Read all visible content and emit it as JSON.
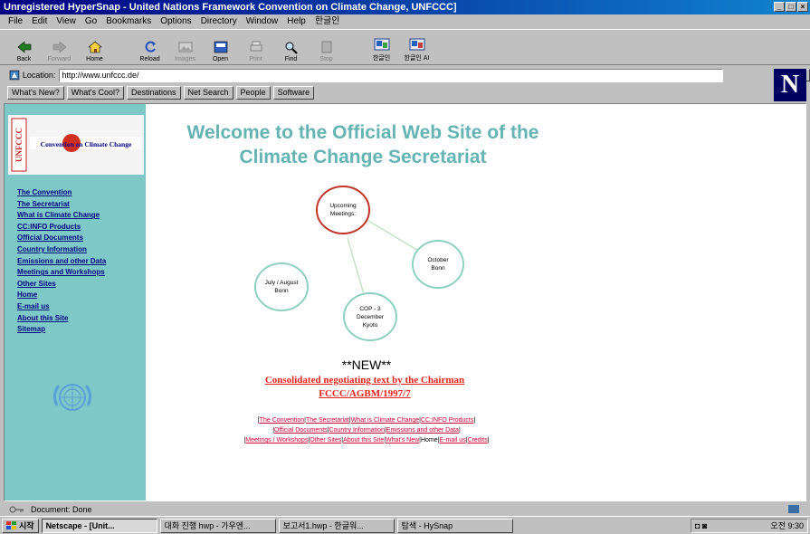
{
  "window": {
    "title": "Unregistered HyperSnap - United Nations Framework Convention on Climate Change, UNFCCC]",
    "controls": [
      "_",
      "□",
      "×"
    ]
  },
  "menu": [
    "File",
    "Edit",
    "View",
    "Go",
    "Bookmarks",
    "Options",
    "Directory",
    "Window",
    "Help",
    "한글인"
  ],
  "toolbar": {
    "buttons": [
      {
        "label": "Back",
        "icon": "back-icon",
        "enabled": true
      },
      {
        "label": "Forward",
        "icon": "forward-icon",
        "enabled": false
      },
      {
        "label": "Home",
        "icon": "home-icon",
        "enabled": true
      },
      {
        "label": "Reload",
        "icon": "reload-icon",
        "enabled": true
      },
      {
        "label": "Images",
        "icon": "images-icon",
        "enabled": false
      },
      {
        "label": "Open",
        "icon": "open-icon",
        "enabled": true
      },
      {
        "label": "Print",
        "icon": "print-icon",
        "enabled": false
      },
      {
        "label": "Find",
        "icon": "find-icon",
        "enabled": true
      },
      {
        "label": "Stop",
        "icon": "stop-icon",
        "enabled": false
      },
      {
        "label": "한글인",
        "icon": "hangul-icon",
        "enabled": true
      },
      {
        "label": "한글인 AI",
        "icon": "hangul-ai-icon",
        "enabled": true
      }
    ]
  },
  "location": {
    "label": "Location:",
    "url": "http://www.unfccc.de/"
  },
  "directory_buttons": [
    "What's New?",
    "What's Cool?",
    "Destinations",
    "Net Search",
    "People",
    "Software"
  ],
  "brand_logo": "N",
  "sidebar": {
    "logo_text_vertical": "UNFCCC",
    "logo_text": "Convention on Climate Change",
    "nav": [
      "The Convention",
      "The Secretariat",
      "What is Climate Change",
      "CC:INFO Products",
      "Official Documents",
      "Country Information",
      "Emissions and other Data",
      "Meetings and Workshops",
      "Other Sites",
      "Home",
      "E-mail us",
      "About this Site",
      "Sitemap"
    ]
  },
  "main": {
    "title_line1": "Welcome to the Official Web Site of the",
    "title_line2": "Climate Change Secretariat",
    "bubbles": [
      {
        "id": "upcoming",
        "line1": "Upcoming",
        "line2": "Meetings:",
        "line3": ""
      },
      {
        "id": "october",
        "line1": "October",
        "line2": "Bonn",
        "line3": ""
      },
      {
        "id": "july",
        "line1": "July / August",
        "line2": "Bonn",
        "line3": ""
      },
      {
        "id": "cop3",
        "line1": "COP - 3",
        "line2": "December",
        "line3": "Kyoto"
      }
    ],
    "new_label": "**NEW**",
    "consolidated_line1": "Consolidated negotiating text by the Chairman",
    "consolidated_line2": "FCCC/AGBM/1997/7"
  },
  "footer": {
    "row1": [
      "The Convention",
      "The Secretariat",
      "What is Climate Change",
      "CC:INFO Products"
    ],
    "row2": [
      "Official Documents",
      "Country Information",
      "Emissions and other Data"
    ],
    "row3": [
      "Meetings / Workshops",
      "Other Sites",
      "About this Site",
      "What's New",
      "Home",
      "E-mail us",
      "Credits"
    ]
  },
  "status": {
    "text": "Document: Done"
  },
  "taskbar": {
    "start": "시작",
    "tasks": [
      {
        "label": "Netscape - [Unit...",
        "active": true
      },
      {
        "label": "대화 진행 hwp - 가우엔...",
        "active": false
      },
      {
        "label": "보고서1.hwp - 한글워...",
        "active": false
      },
      {
        "label": "탐색 - HySnap",
        "active": false
      }
    ],
    "clock": "오전 9:30"
  },
  "colors": {
    "sidebar": "#7ec8c8",
    "title": "#66b3b3",
    "link_nav": "#000080",
    "link_red": "#e8221a",
    "bubble_red": "#c0352a",
    "bubble_teal": "#8fd0c0"
  }
}
